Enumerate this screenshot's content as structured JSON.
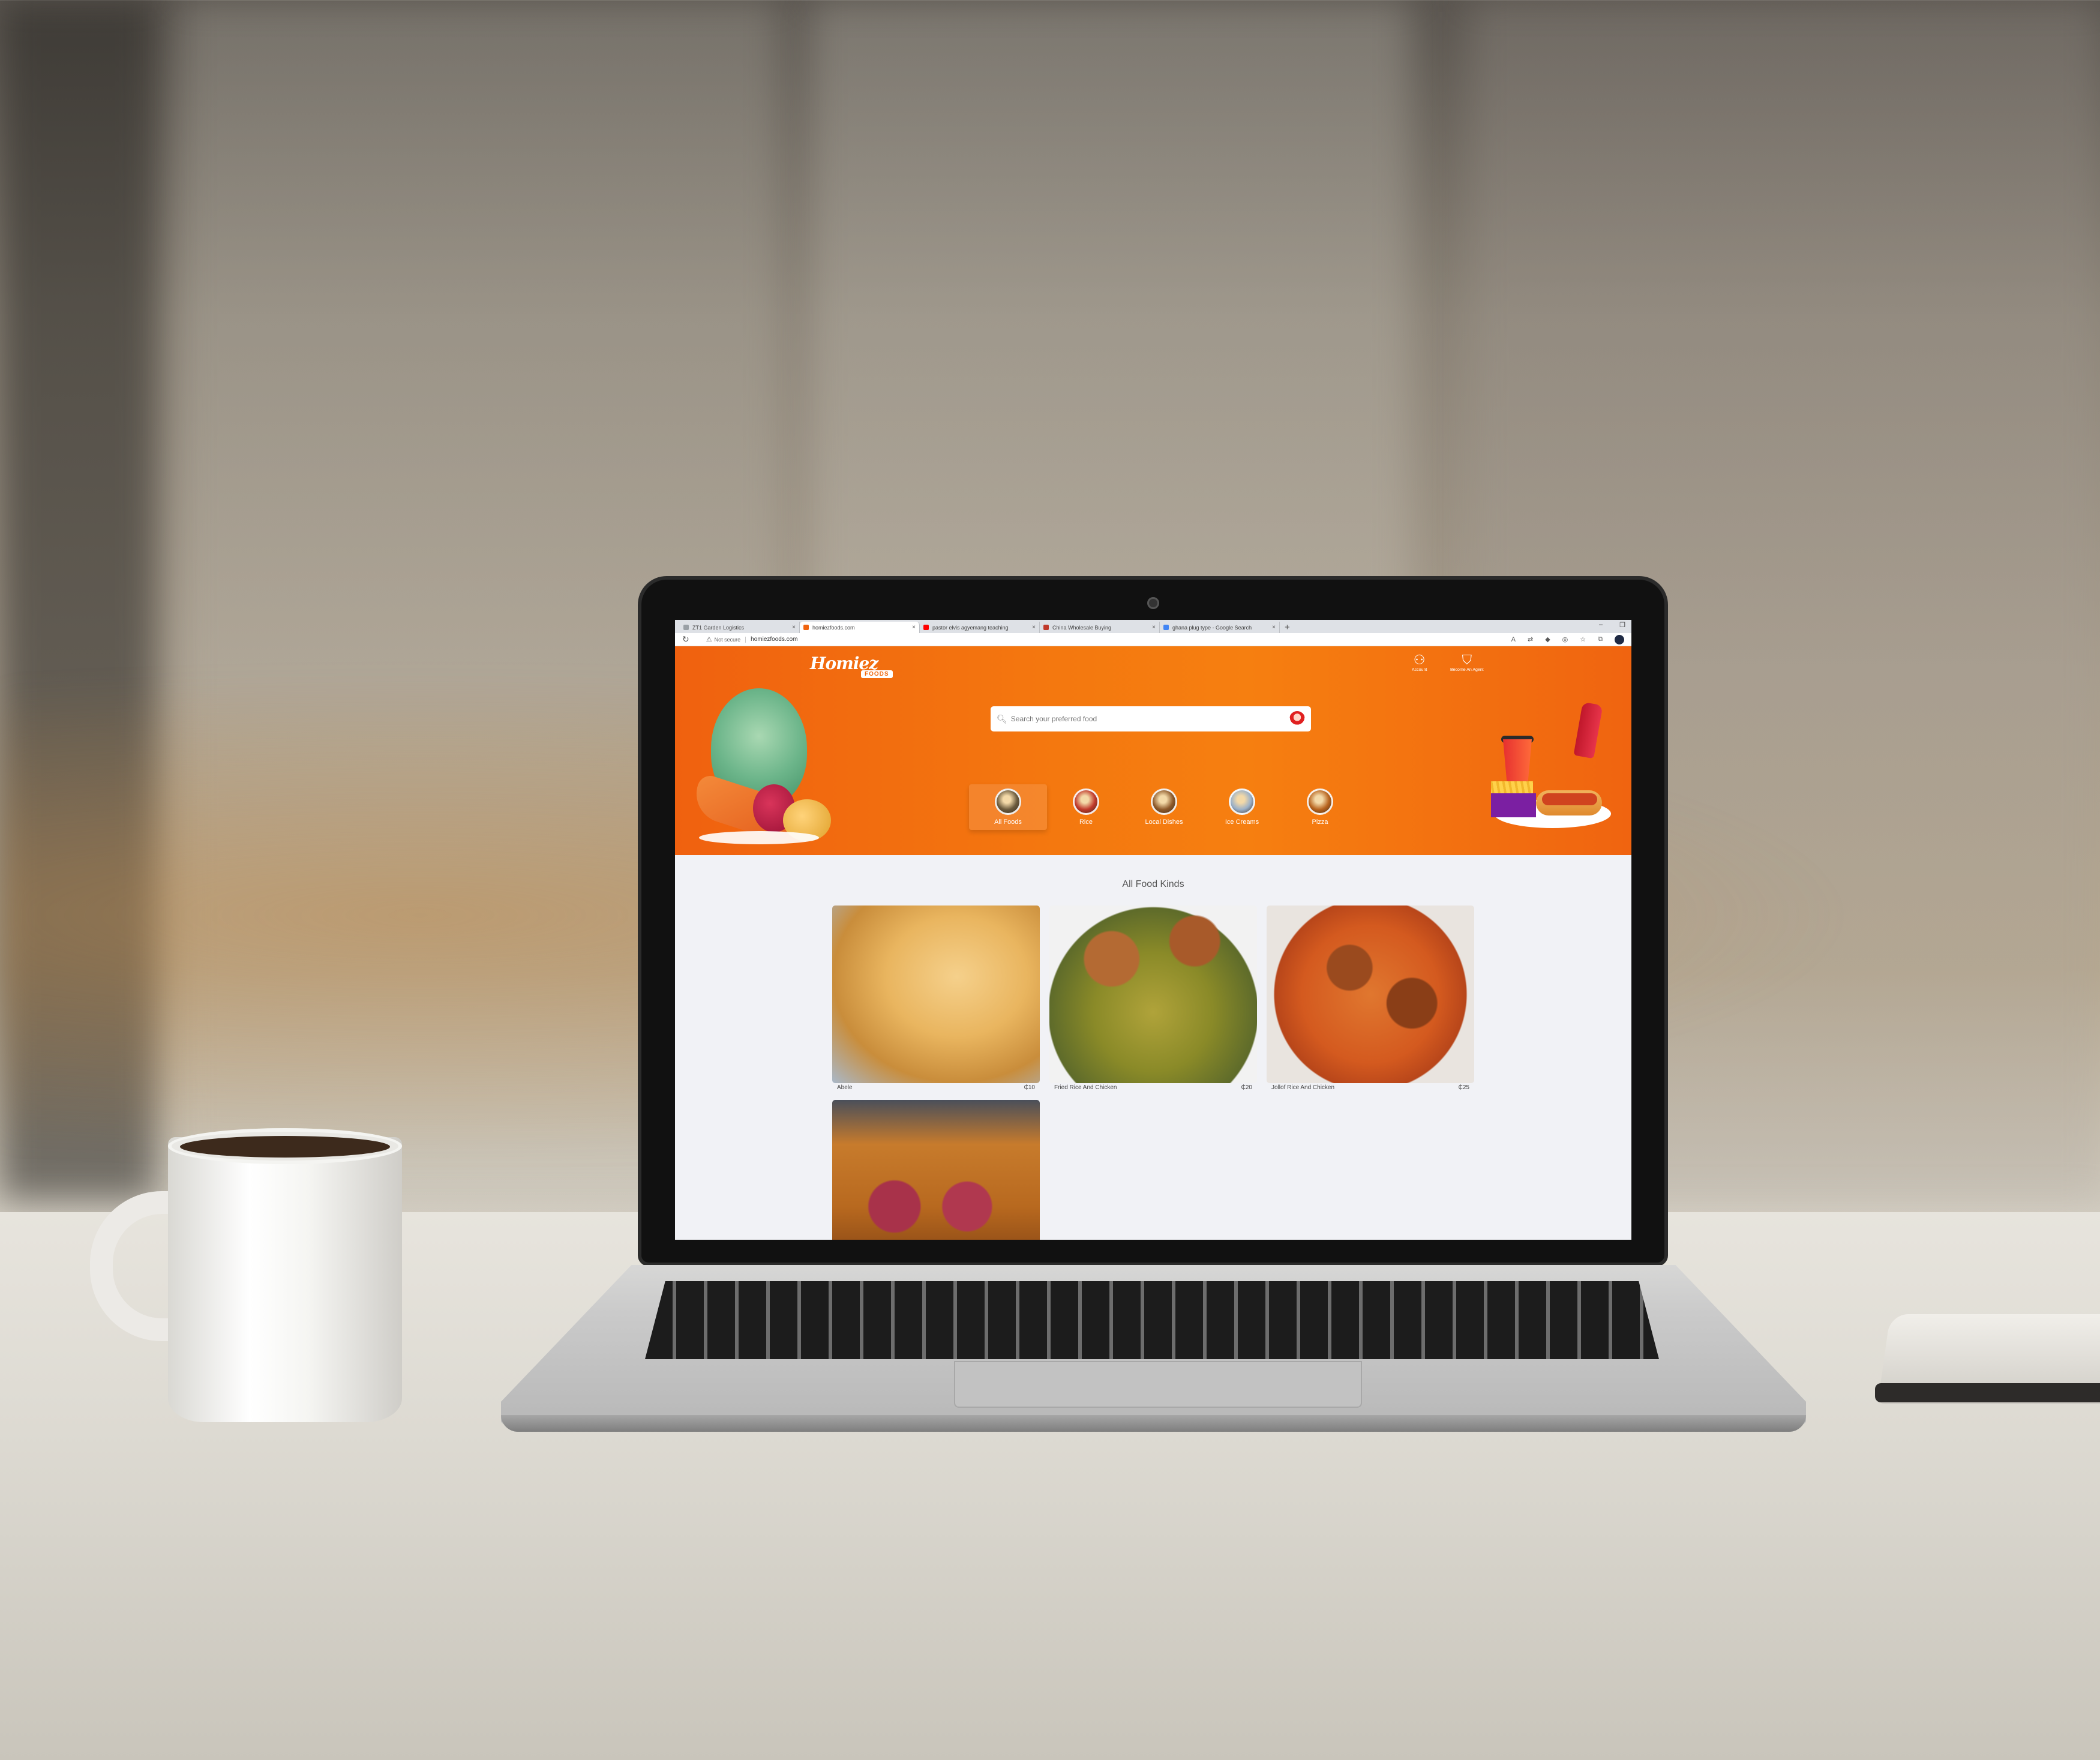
{
  "browser": {
    "tabs": [
      {
        "title": "ZT1 Garden Logistics",
        "active": false,
        "favicon_color": "#9aa0a6"
      },
      {
        "title": "homiezfoods.com",
        "active": true,
        "favicon_color": "#f06410"
      },
      {
        "title": "pastor elvis agyemang teaching",
        "active": false,
        "favicon_color": "#ff0000"
      },
      {
        "title": "China Wholesale Buying",
        "active": false,
        "favicon_color": "#c0392b"
      },
      {
        "title": "ghana plug type - Google Search",
        "active": false,
        "favicon_color": "#4285f4"
      }
    ],
    "tab_close_glyph": "×",
    "new_tab_glyph": "+",
    "window_controls": {
      "minimize": "–",
      "restore": "❐"
    },
    "address": {
      "security_label": "Not secure",
      "url": "homiezfoods.com"
    },
    "icons": [
      "reload-icon",
      "warning-icon",
      "read-aloud-icon",
      "translate-icon",
      "extension-icon",
      "copilot-icon",
      "favorites-icon",
      "collections-icon",
      "profile-icon"
    ]
  },
  "header": {
    "logo_text": "Homiez",
    "logo_badge": "FOODS",
    "account_label": "Account",
    "agent_label": "Become An Agent"
  },
  "search": {
    "placeholder": "Search your preferred food"
  },
  "categories": [
    {
      "label": "All Foods",
      "active": true,
      "color": "#6b5b3e"
    },
    {
      "label": "Rice",
      "active": false,
      "color": "#c0392b"
    },
    {
      "label": "Local Dishes",
      "active": false,
      "color": "#8e5a2b"
    },
    {
      "label": "Ice Creams",
      "active": false,
      "color": "#9ab0c8"
    },
    {
      "label": "Pizza",
      "active": false,
      "color": "#b8641e"
    }
  ],
  "section": {
    "title": "All Food Kinds"
  },
  "foods": [
    {
      "name": "Abele",
      "price": "₵10"
    },
    {
      "name": "Fried Rice And Chicken",
      "price": "₵20"
    },
    {
      "name": "Jollof Rice And Chicken",
      "price": "₵25"
    },
    {
      "name": "",
      "price": ""
    }
  ],
  "colors": {
    "brand_orange": "#f06410",
    "content_bg": "#f1f2f6"
  }
}
